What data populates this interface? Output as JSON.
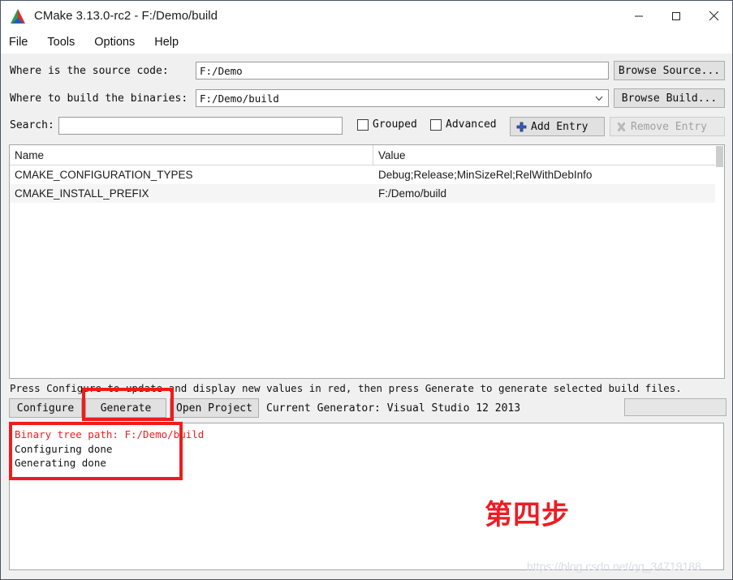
{
  "window": {
    "title": "CMake 3.13.0-rc2 - F:/Demo/build",
    "logo_icon": "cmake-logo-icon",
    "minimize_icon": "minimize-icon",
    "maximize_icon": "maximize-icon",
    "close_icon": "close-icon"
  },
  "menu": {
    "items": [
      {
        "label": "File"
      },
      {
        "label": "Tools"
      },
      {
        "label": "Options"
      },
      {
        "label": "Help"
      }
    ]
  },
  "source_row": {
    "label": "Where is the source code:",
    "value": "F:/Demo",
    "placeholder": "",
    "browse_label": "Browse Source..."
  },
  "build_row": {
    "label": "Where to build the binaries:",
    "value": "F:/Demo/build",
    "placeholder": "",
    "browse_label": "Browse Build...",
    "dropdown_icon": "chevron-down-icon"
  },
  "search_row": {
    "label": "Search:",
    "value": "",
    "placeholder": "",
    "grouped_label": "Grouped",
    "grouped_checked": false,
    "advanced_label": "Advanced",
    "advanced_checked": false,
    "add_entry_label": "Add Entry",
    "add_entry_icon": "plus-icon",
    "remove_entry_label": "Remove Entry",
    "remove_entry_icon": "remove-x-icon",
    "remove_entry_disabled": true
  },
  "cache_table": {
    "columns": [
      "Name",
      "Value"
    ],
    "rows": [
      {
        "name": "CMAKE_CONFIGURATION_TYPES",
        "value": "Debug;Release;MinSizeRel;RelWithDebInfo"
      },
      {
        "name": "CMAKE_INSTALL_PREFIX",
        "value": "F:/Demo/build"
      }
    ]
  },
  "hint": "Press Configure to update and display new values in red, then press Generate to generate selected build files.",
  "actions": {
    "configure_label": "Configure",
    "generate_label": "Generate",
    "open_project_label": "Open Project",
    "current_generator": "Current Generator: Visual Studio 12 2013",
    "progress_value": ""
  },
  "output_log": {
    "lines": [
      {
        "text": "Binary tree path: F:/Demo/build",
        "color": "#ee1c25"
      },
      {
        "text": "Configuring done",
        "color": "#111111"
      },
      {
        "text": "Generating done",
        "color": "#111111"
      }
    ]
  },
  "annotations": {
    "step_text": "第四步",
    "step_color": "#ed1c24",
    "highlight_color": "#f01b1b",
    "watermark": "https://blog.csdn.net/qq_34719188"
  }
}
